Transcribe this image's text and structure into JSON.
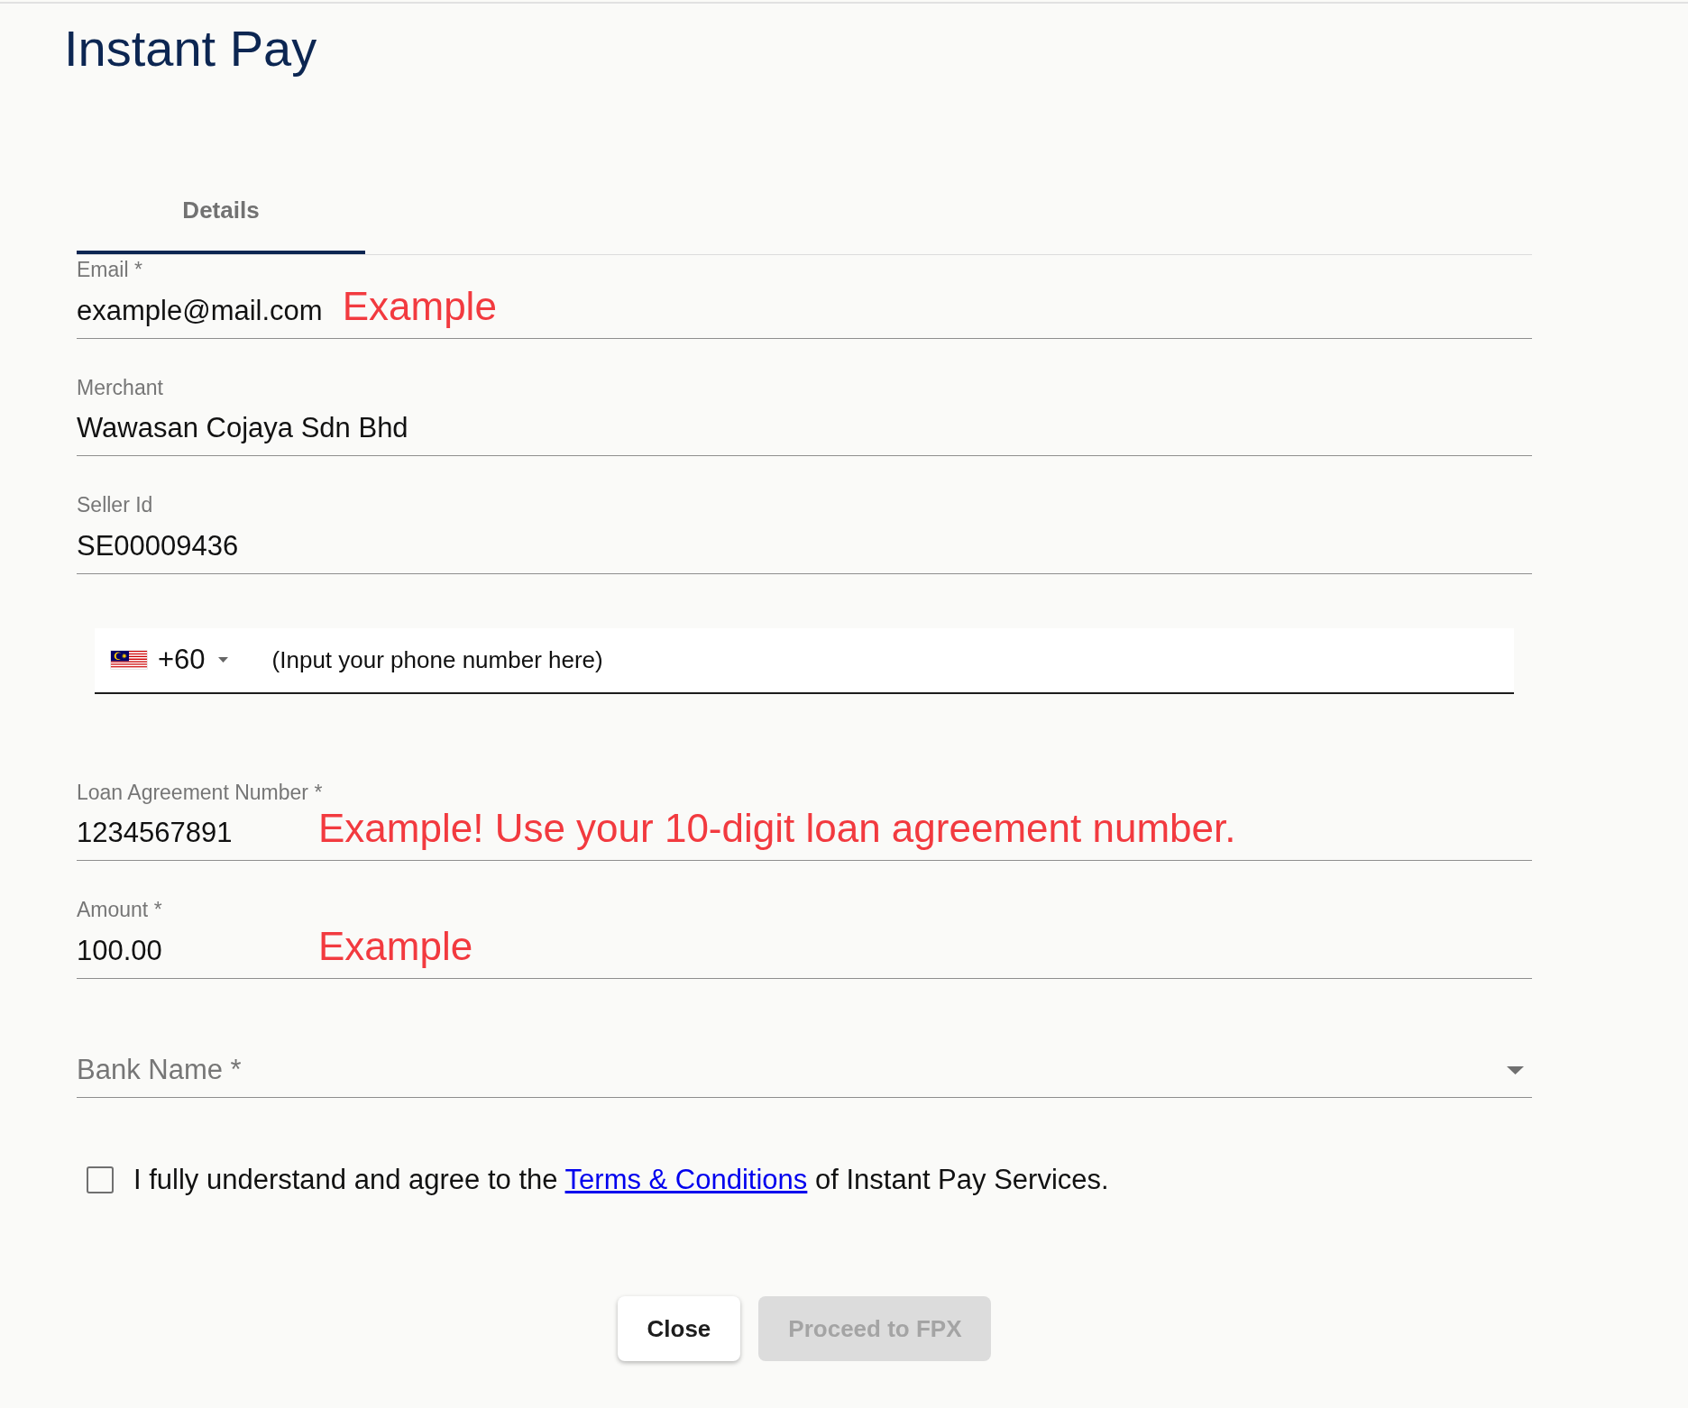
{
  "title": "Instant Pay",
  "tabs": [
    {
      "label": "Details",
      "selected": true
    }
  ],
  "fields": [
    {
      "kind": "text",
      "label": "Email *",
      "value": "example@mail.com",
      "note": "Example"
    },
    {
      "kind": "text",
      "label": "Merchant",
      "value": "Wawasan Cojaya Sdn Bhd"
    },
    {
      "kind": "text",
      "label": "Seller Id",
      "value": "SE00009436"
    },
    {
      "kind": "phone",
      "dial_code": "+60",
      "value": "(Input your phone number here)"
    },
    {
      "kind": "text",
      "label": "Loan Agreement Number *",
      "value": "1234567891",
      "note": "Example! Use your 10-digit loan agreement number."
    },
    {
      "kind": "text",
      "label": "Amount *",
      "value": "100.00",
      "note": "Example"
    },
    {
      "kind": "select",
      "label": "Bank Name *"
    }
  ],
  "agreement": {
    "checked": false,
    "text_before": "I fully understand and agree to the",
    "link": "Terms & Conditions",
    "text_after": "of Instant Pay Services."
  },
  "buttons": [
    {
      "kind": "close",
      "label": "Close",
      "disabled": false
    },
    {
      "kind": "submit",
      "label": "Proceed to FPX",
      "disabled": true
    }
  ]
}
